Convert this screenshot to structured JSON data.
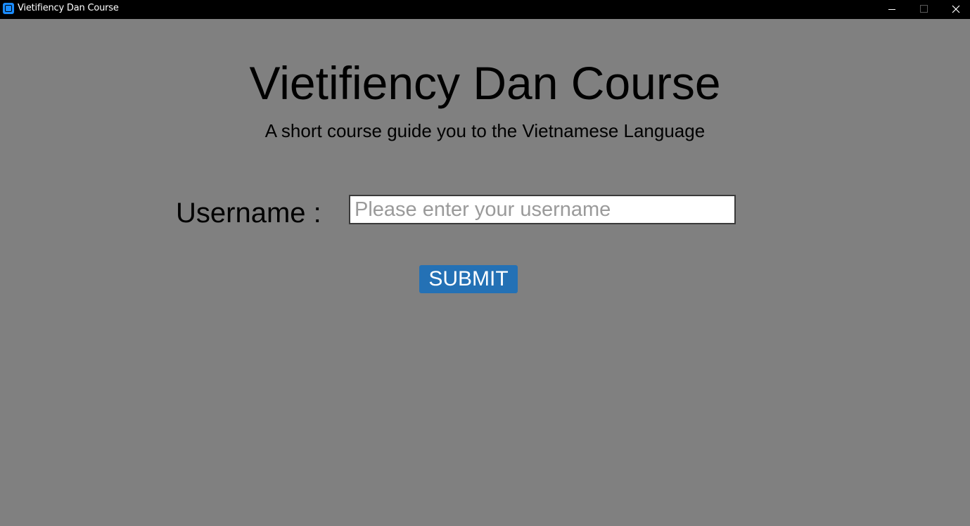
{
  "window": {
    "title": "Vietifiency Dan Course",
    "app_icon": "app-icon",
    "controls": {
      "minimize_icon": "minimize-icon",
      "maximize_icon": "maximize-icon",
      "close_icon": "close-icon"
    }
  },
  "main": {
    "title": "Vietifiency Dan Course",
    "subtitle": "A short course guide you to the Vietnamese Language",
    "username_label": "Username :",
    "username_input": {
      "value": "",
      "placeholder": "Please enter your username"
    },
    "submit_label": "SUBMIT"
  },
  "colors": {
    "background": "#808080",
    "titlebar": "#000000",
    "submit_button": "#2471b5",
    "input_background": "#ffffff"
  }
}
